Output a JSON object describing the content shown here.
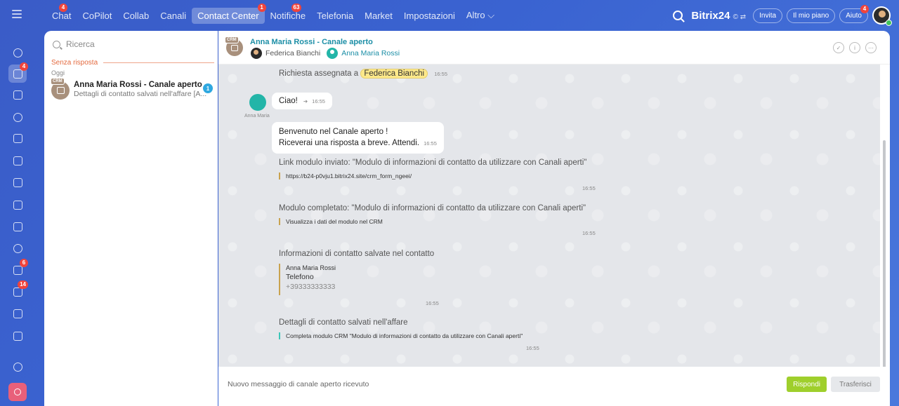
{
  "topbar": {
    "nav": [
      {
        "label": "Chat",
        "badge": "4"
      },
      {
        "label": "CoPilot",
        "badge": ""
      },
      {
        "label": "Collab",
        "badge": ""
      },
      {
        "label": "Canali",
        "badge": ""
      },
      {
        "label": "Contact Center",
        "badge": "1",
        "active": true
      },
      {
        "label": "Notifiche",
        "badge": "63"
      },
      {
        "label": "Telefonia",
        "badge": ""
      },
      {
        "label": "Market",
        "badge": ""
      },
      {
        "label": "Impostazioni",
        "badge": ""
      },
      {
        "label": "Altro ⌵",
        "badge": ""
      }
    ],
    "logo": "Bitrix24",
    "logo_suffix": "© ⇄",
    "invite": "Invita",
    "plan": "Il mio piano",
    "help": "Aiuto",
    "help_badge": "4"
  },
  "rail": {
    "badges": {
      "chat": "4",
      "tasks": "6",
      "crm": "14"
    }
  },
  "list": {
    "search_placeholder": "Ricerca",
    "section": "Senza risposta",
    "day": "Oggi",
    "chat": {
      "tag": "CRM",
      "title": "Anna Maria Rossi - Canale aperto",
      "subtitle": "Dettagli di contatto salvati nell'affare [A...",
      "count": "1"
    }
  },
  "chat": {
    "tag": "CRM",
    "title": "Anna Maria Rossi - Canale aperto",
    "member1": "Federica Bianchi",
    "member2": "Anna Maria Rossi",
    "assigned_prefix": "Richiesta assegnata a",
    "assigned_to": "Federica Bianchi",
    "assigned_time": "16:55",
    "anna_name": "Anna Maria",
    "msg1": "Ciao!",
    "msg1_time": "16:55",
    "msg2_line1": "Benvenuto nel Canale aperto !",
    "msg2_line2": "Riceverai una risposta a breve. Attendi.",
    "msg2_time": "16:55",
    "card1_title": "Link modulo inviato: \"Modulo di informazioni di contatto da utilizzare con Canali aperti\"",
    "card1_body": "https://b24-p0vju1.bitrix24.site/crm_form_ngeei/",
    "card1_time": "16:55",
    "card2_title": "Modulo completato: \"Modulo di informazioni di contatto da utilizzare con Canali aperti\"",
    "card2_body": "Visualizza i dati del modulo nel CRM",
    "card2_time": "16:55",
    "card3_title": "Informazioni di contatto salvate nel contatto",
    "card3_name": "Anna Maria Rossi",
    "card3_label": "Telefono",
    "card3_value": "+39333333333",
    "card3_time": "16:55",
    "card4_title": "Dettagli di contatto salvati nell'affare",
    "card4_body": "Completa modulo CRM \"Modulo di informazioni di contatto da utilizzare con Canali aperti\"",
    "card4_time": "16:55",
    "footer_text": "Nuovo messaggio di canale aperto ricevuto",
    "reply": "Rispondi",
    "transfer": "Trasferisci"
  }
}
